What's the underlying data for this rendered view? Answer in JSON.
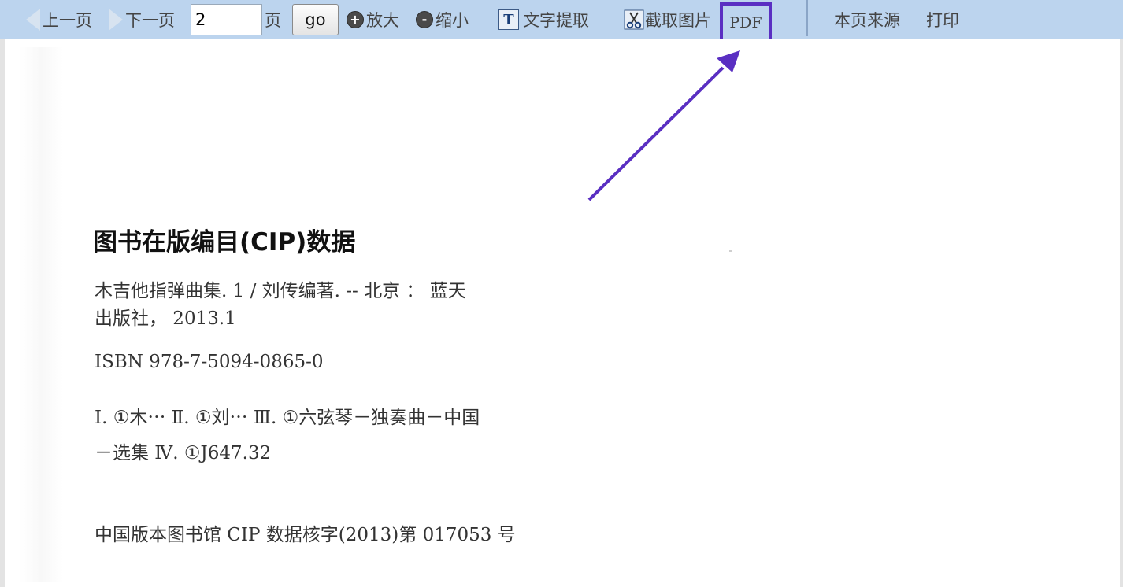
{
  "toolbar": {
    "prev_label": "上一页",
    "next_label": "下一页",
    "page_value": "2",
    "page_unit": "页",
    "go_label": "go",
    "zoom_in_label": "放大",
    "zoom_out_label": "缩小",
    "zoom_in_symbol": "+",
    "zoom_out_symbol": "-",
    "text_extract_label": "文字提取",
    "text_extract_icon_glyph": "T",
    "capture_label": "截取图片",
    "pdf_label": "PDF",
    "source_label": "本页来源",
    "print_label": "打印"
  },
  "document": {
    "title": "图书在版编目(CIP)数据",
    "line1": "木吉他指弹曲集. 1 / 刘传编著. -- 北京 ： 蓝天",
    "line2": "出版社， 2013.1",
    "isbn": "ISBN 978-7-5094-0865-0",
    "class_line1": "Ⅰ. ①木⋯ Ⅱ. ①刘⋯ Ⅲ. ①六弦琴－独奏曲－中国",
    "class_line2": "－选集 Ⅳ. ①J647.32",
    "cip_line": "中国版本图书馆 CIP 数据核字(2013)第 017053 号"
  },
  "colors": {
    "toolbar_bg": "#bcd4ee",
    "highlight": "#5a2fc2"
  },
  "icons": {
    "prev": "triangle-left-icon",
    "next": "triangle-right-icon",
    "zoom_in": "plus-circle-icon",
    "zoom_out": "minus-circle-icon",
    "text_extract": "text-extract-icon",
    "capture": "scissors-icon"
  }
}
